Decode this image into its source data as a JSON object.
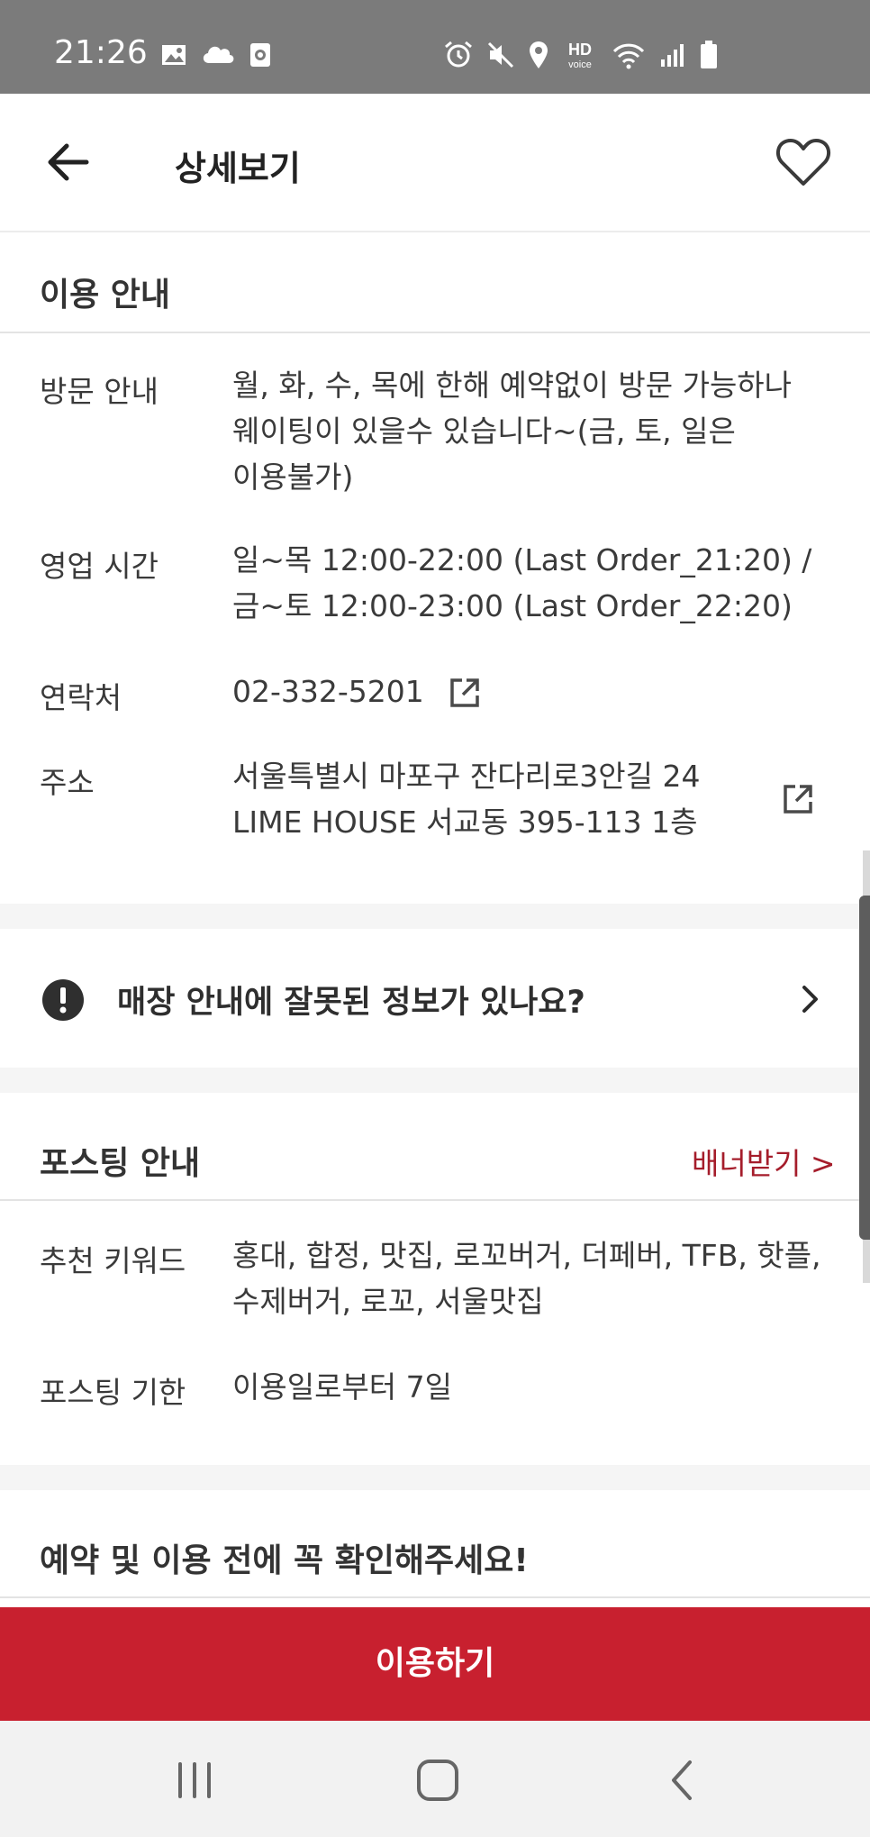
{
  "status_bar": {
    "time": "21:26",
    "left_icons": [
      "gallery-icon",
      "cloud-icon",
      "screen-record-icon"
    ],
    "right_icons": [
      "alarm-icon",
      "mute-icon",
      "location-icon",
      "hd-voice-icon",
      "wifi-icon",
      "signal-icon",
      "battery-icon"
    ],
    "hd_top": "HD",
    "hd_bottom": "voice"
  },
  "header": {
    "title": "상세보기",
    "back_icon": "arrow-left-icon",
    "favorite_icon": "heart-outline-icon"
  },
  "usage_info": {
    "title": "이용 안내",
    "rows": [
      {
        "label": "방문 안내",
        "lines": [
          "월, 화, 수, 목에 한해 예약없이 방문 가능하나",
          "웨이팅이 있을수 있습니다~(금, 토, 일은",
          "이용불가)"
        ]
      },
      {
        "label": "영업 시간",
        "lines": [
          "일~목 12:00-22:00 (Last Order_21:20) /",
          "금~토 12:00-23:00 (Last Order_22:20)"
        ]
      },
      {
        "label": "연락처",
        "lines": [
          "02-332-5201"
        ],
        "icon": "external-link-icon"
      },
      {
        "label": "주소",
        "lines": [
          "서울특별시 마포구 잔다리로3안길 24",
          "LIME HOUSE 서교동 395-113 1층"
        ],
        "icon": "external-link-icon"
      }
    ]
  },
  "report": {
    "text": "매장 안내에 잘못된 정보가 있나요?",
    "icon": "alert-circle-icon",
    "chevron": "chevron-right-icon"
  },
  "posting_info": {
    "title": "포스팅 안내",
    "banner_link": "배너받기 >",
    "rows": [
      {
        "label": "추천 키워드",
        "lines": [
          "홍대, 합정, 맛집, 로꼬버거, 더페버, TFB, 핫플,",
          "수제버거, 로꼬, 서울맛집"
        ]
      },
      {
        "label": "포스팅 기한",
        "lines": [
          "이용일로부터 7일"
        ]
      }
    ]
  },
  "notice": {
    "title": "예약 및 이용 전에 꼭 확인해주세요!"
  },
  "cta": {
    "label": "이용하기"
  },
  "nav_bar": {
    "icons": [
      "recent-apps-icon",
      "home-icon",
      "back-icon"
    ]
  },
  "colors": {
    "accent": "#c8202f",
    "banner_link": "#a51d2b",
    "status_bar": "#7b7b7b"
  }
}
